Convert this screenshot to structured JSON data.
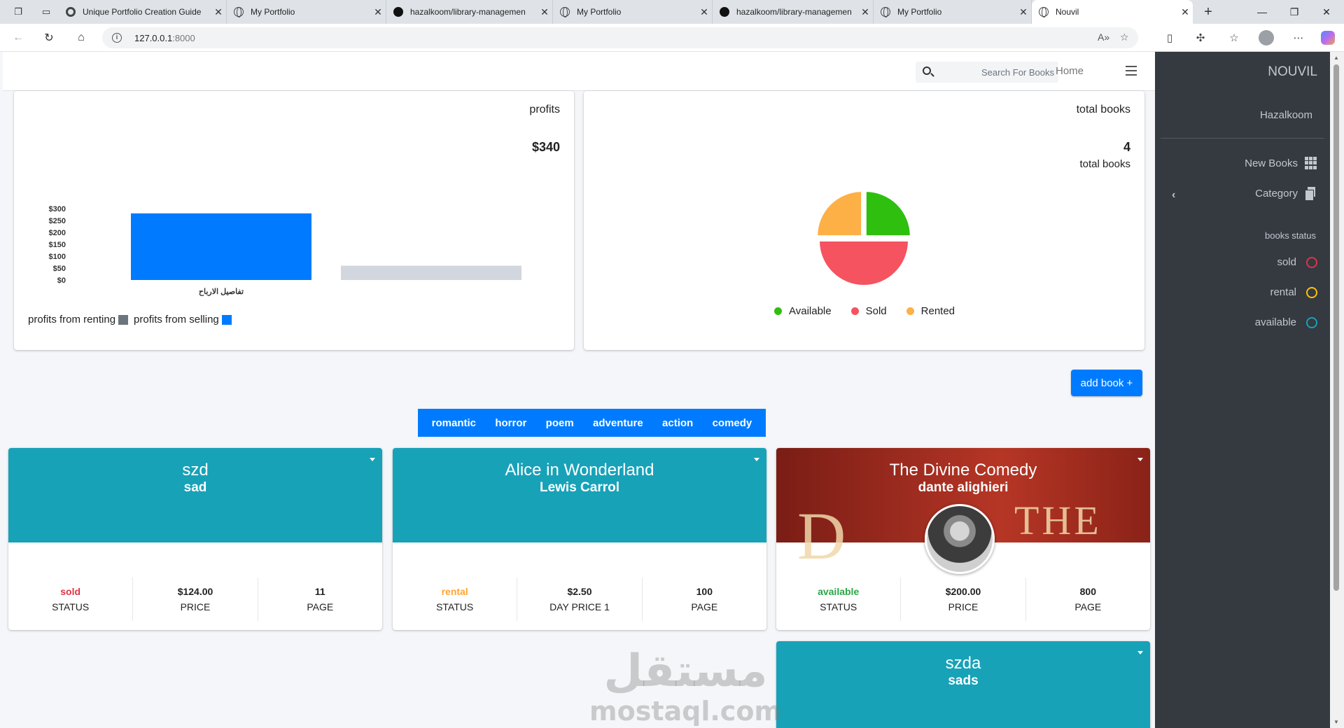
{
  "browser": {
    "tabs": [
      {
        "title": "Unique Portfolio Creation Guide",
        "icon": "chatgpt-icon"
      },
      {
        "title": "My Portfolio",
        "icon": "globe-icon"
      },
      {
        "title": "hazalkoom/library-managemen",
        "icon": "github-icon"
      },
      {
        "title": "My Portfolio",
        "icon": "globe-icon"
      },
      {
        "title": "hazalkoom/library-managemen",
        "icon": "github-icon"
      },
      {
        "title": "My Portfolio",
        "icon": "globe-icon"
      },
      {
        "title": "Nouvil",
        "icon": "globe-icon",
        "active": true
      }
    ],
    "url_host": "127.0.0.1",
    "url_port": ":8000"
  },
  "topnav": {
    "search_placeholder": "Search For Books",
    "home_label": "Home"
  },
  "profits_card": {
    "title": "profits",
    "amount": "$340",
    "legend_renting": "profits from renting",
    "legend_selling": "profits from selling"
  },
  "books_card": {
    "title": "total books",
    "count": "4",
    "subtitle": "total books",
    "legend": [
      "Available",
      "Sold",
      "Rented"
    ]
  },
  "chart_data": [
    {
      "type": "bar",
      "categories": [
        "تفاصيل الارباح"
      ],
      "series": [
        {
          "name": "profits from selling",
          "values": [
            280
          ],
          "color": "#007bff"
        },
        {
          "name": "profits from renting",
          "values": [
            60
          ],
          "color": "#d2d6de"
        }
      ],
      "ylim": [
        0,
        300
      ],
      "yticks": [
        "$0",
        "$50",
        "$100",
        "$150",
        "$200",
        "$250",
        "$300"
      ],
      "xlabel": "تفاصيل الارباح",
      "grid": false,
      "legend": "bottom-left"
    },
    {
      "type": "pie",
      "categories": [
        "Available",
        "Sold",
        "Rented"
      ],
      "values": [
        1,
        2,
        1
      ],
      "colors": [
        "#2fbf0f",
        "#f5535f",
        "#fdb046"
      ],
      "legend": "bottom"
    }
  ],
  "add_book_label": "add book +",
  "categories": [
    "romantic",
    "horror",
    "poem",
    "adventure",
    "action",
    "comedy"
  ],
  "books": [
    {
      "name": "szd",
      "author": "sad",
      "status": "sold",
      "price": "$124.00",
      "price_label": "PRICE",
      "pages": "11"
    },
    {
      "name": "Alice in Wonderland",
      "author": "Lewis Carrol",
      "status": "rental",
      "price": "$2.50",
      "price_label": "DAY PRICE 1",
      "pages": "100"
    },
    {
      "name": "The Divine Comedy",
      "author": "dante alighieri",
      "status": "available",
      "price": "$200.00",
      "price_label": "PRICE",
      "pages": "800"
    },
    {
      "name": "szda",
      "author": "sads"
    }
  ],
  "stat_labels": {
    "status": "STATUS",
    "page": "PAGE"
  },
  "sidebar": {
    "brand": "NOUVIL",
    "user": "Hazalkoom",
    "new_books": "New Books",
    "category": "Category",
    "status_header": "books status",
    "statuses": [
      {
        "label": "sold",
        "color": "#dc3545"
      },
      {
        "label": "rental",
        "color": "#ffc107"
      },
      {
        "label": "available",
        "color": "#17a2b8"
      }
    ]
  },
  "watermark": {
    "arabic": "مستقل",
    "latin": "mostaql.com"
  }
}
